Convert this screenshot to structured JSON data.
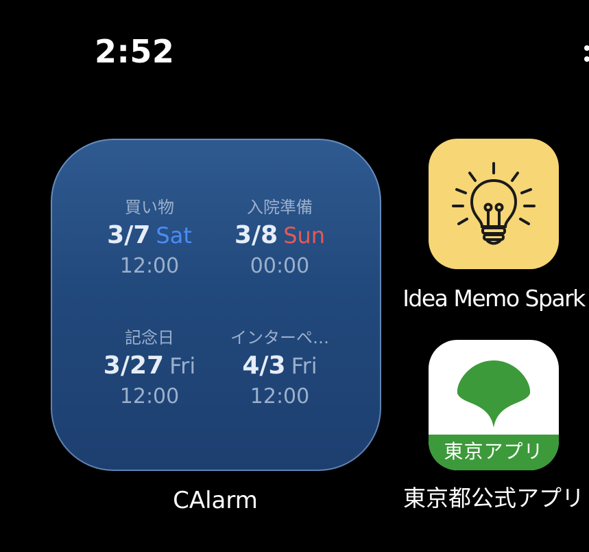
{
  "status_bar": {
    "time": "2:52"
  },
  "widget": {
    "app_label": "CAlarm",
    "alarms": [
      {
        "name": "買い物",
        "date": "3/7",
        "day": "Sat",
        "time": "12:00",
        "day_color": "#4b8cf5"
      },
      {
        "name": "入院準備",
        "date": "3/8",
        "day": "Sun",
        "time": "00:00",
        "day_color": "#e45a57"
      },
      {
        "name": "記念日",
        "date": "3/27",
        "day": "Fri",
        "time": "12:00",
        "day_color": "#9bb0cc"
      },
      {
        "name": "インターペ…",
        "date": "4/3",
        "day": "Fri",
        "time": "12:00",
        "day_color": "#9bb0cc"
      }
    ]
  },
  "apps": [
    {
      "label": "Idea Memo Spark",
      "icon": "lightbulb-icon"
    },
    {
      "label": "東京都公式アプリ",
      "icon": "ginkgo-leaf-icon",
      "icon_text": "東京アプリ"
    }
  ],
  "colors": {
    "widget_blue": "#22497c",
    "idea_yellow": "#f6d675",
    "tokyo_green": "#3c9a3a"
  }
}
